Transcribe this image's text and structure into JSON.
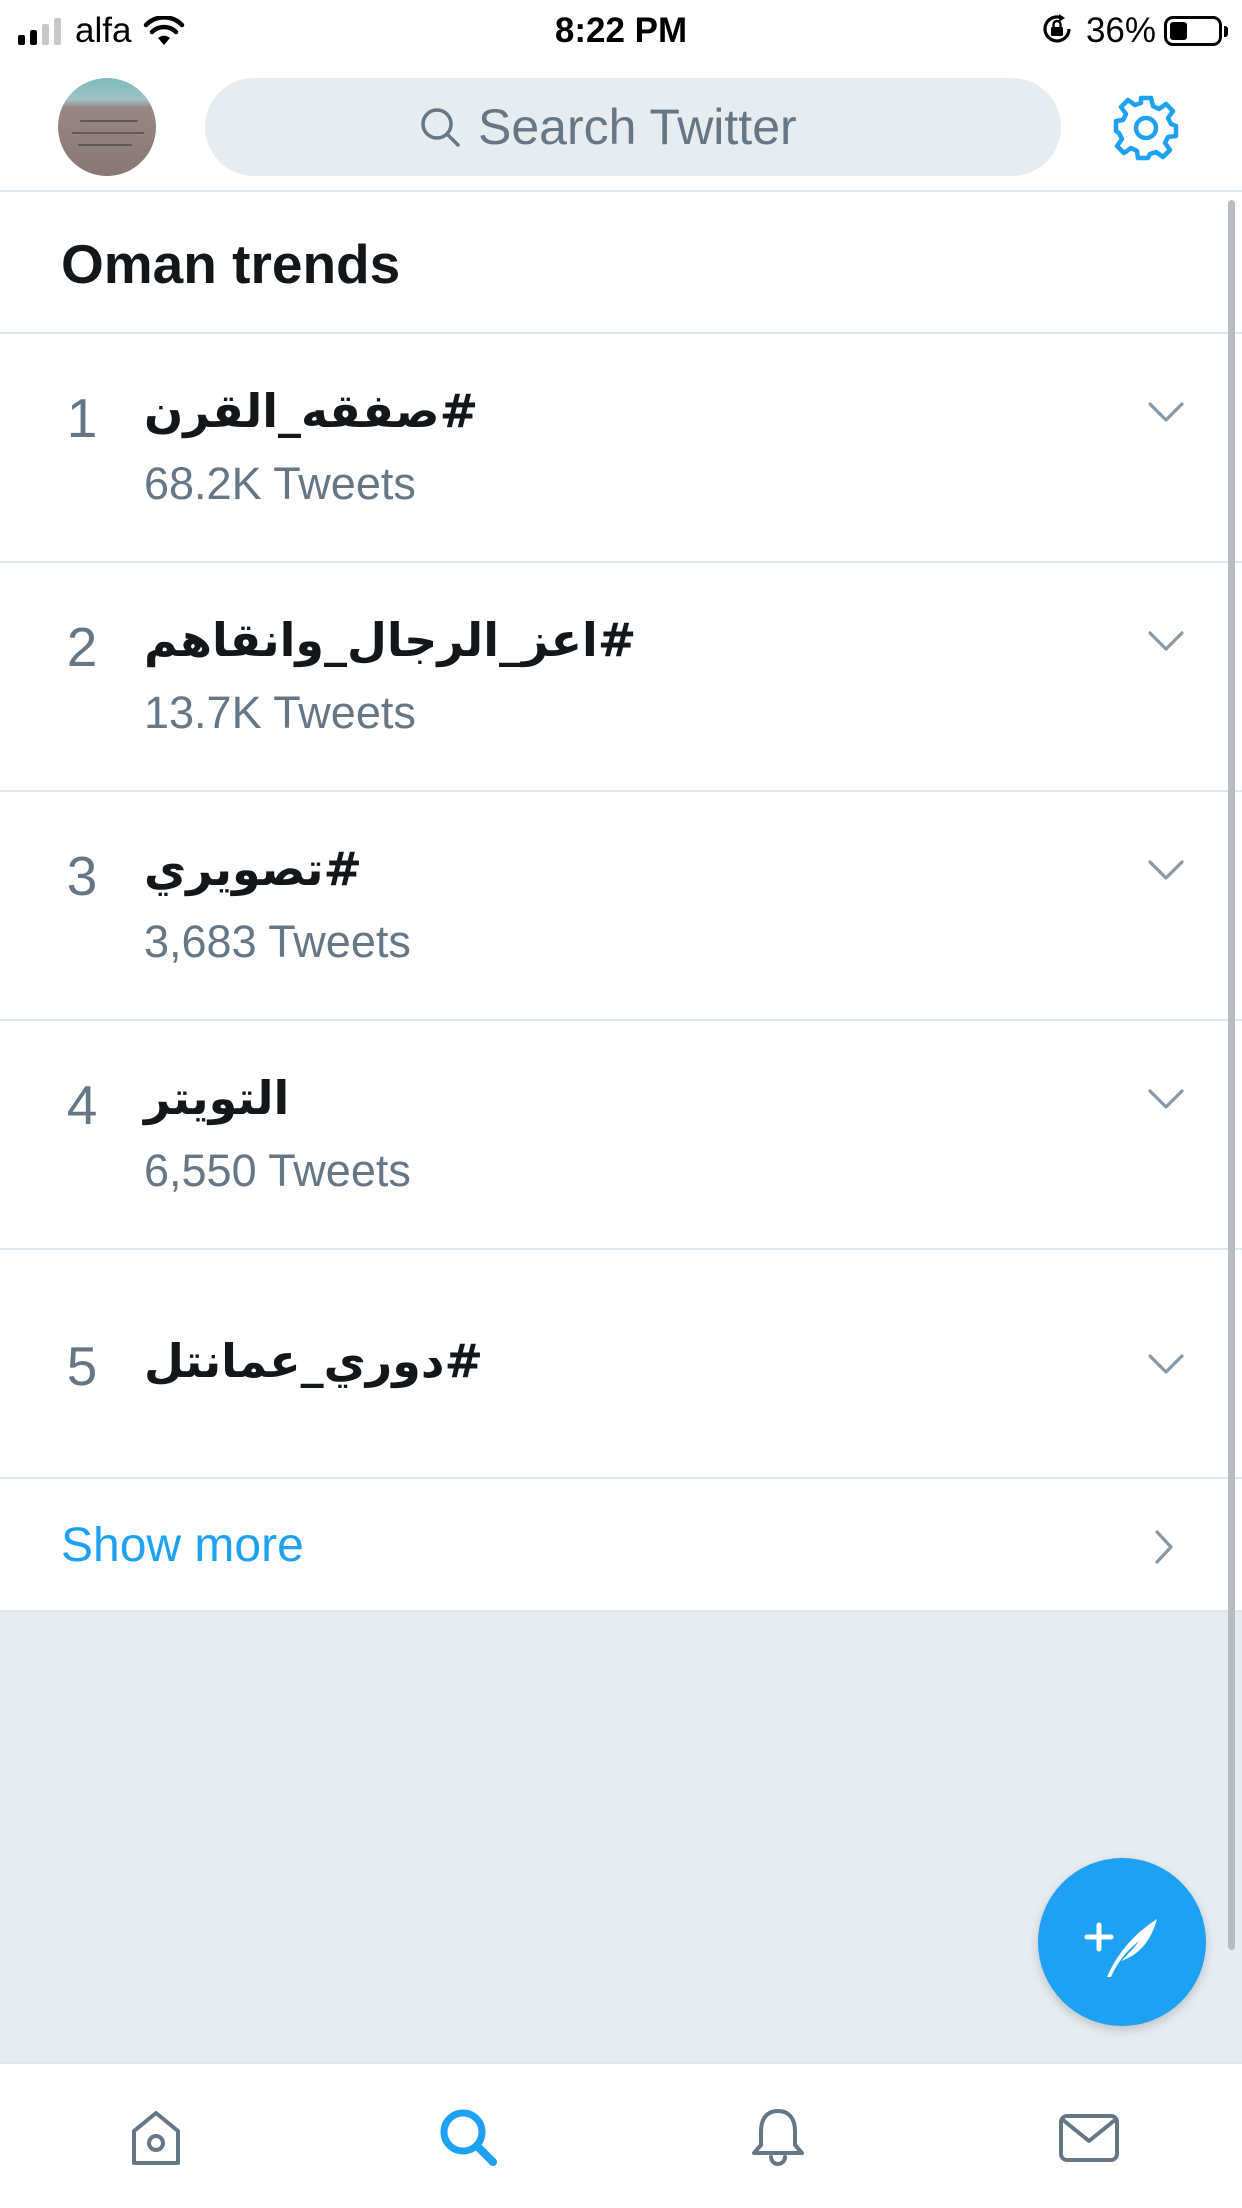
{
  "status_bar": {
    "carrier": "alfa",
    "time": "8:22 PM",
    "battery_percent": "36%",
    "battery_level": 0.36,
    "signal_bars_active": 2,
    "signal_bars_total": 4,
    "icons": [
      "wifi-icon",
      "orientation-lock-icon",
      "battery-icon"
    ]
  },
  "header": {
    "search_placeholder": "Search Twitter",
    "icons": [
      "avatar",
      "search-icon",
      "gear-icon"
    ],
    "accent_color": "#1da1f2"
  },
  "trends": {
    "title": "Oman trends",
    "items": [
      {
        "rank": "1",
        "name": "#صفقه_القرن",
        "count": "68.2K Tweets"
      },
      {
        "rank": "2",
        "name": "#اعز_الرجال_وانقاهم",
        "count": "13.7K Tweets"
      },
      {
        "rank": "3",
        "name": "#تصويري",
        "count": "3,683 Tweets"
      },
      {
        "rank": "4",
        "name": "التويتر",
        "count": "6,550 Tweets"
      },
      {
        "rank": "5",
        "name": "#دوري_عمانتل",
        "count": ""
      }
    ],
    "show_more": "Show more"
  },
  "tab_bar": {
    "tabs": [
      "home-icon",
      "search-icon",
      "bell-icon",
      "mail-icon"
    ],
    "active": "search-icon"
  },
  "fab": {
    "icon": "compose-icon"
  }
}
